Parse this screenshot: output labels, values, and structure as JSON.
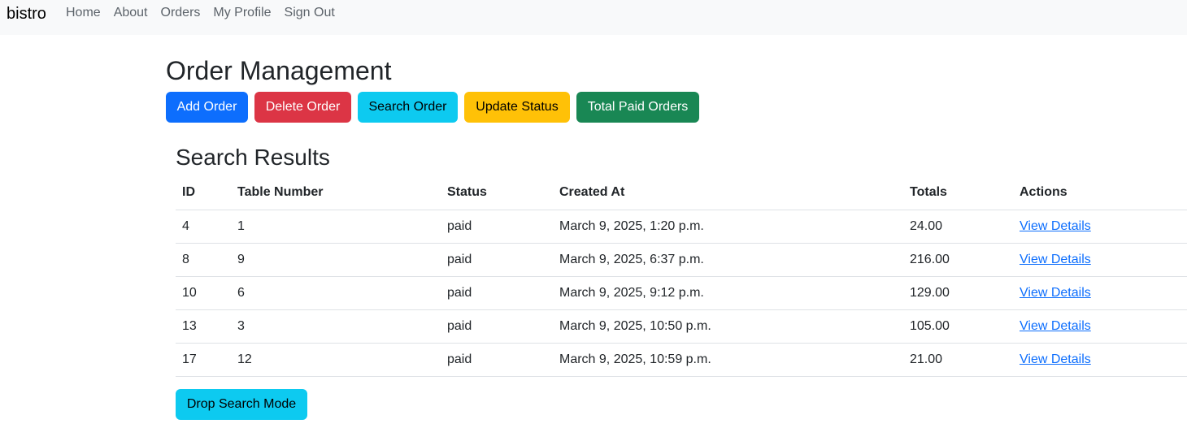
{
  "navbar": {
    "brand": "bistro",
    "links": [
      "Home",
      "About",
      "Orders",
      "My Profile",
      "Sign Out"
    ]
  },
  "page_title": "Order Management",
  "actions": {
    "add": "Add Order",
    "delete": "Delete Order",
    "search": "Search Order",
    "update": "Update Status",
    "total_paid": "Total Paid Orders"
  },
  "results": {
    "title": "Search Results",
    "headers": [
      "ID",
      "Table Number",
      "Status",
      "Created At",
      "Totals",
      "Actions"
    ],
    "rows": [
      {
        "id": "4",
        "table": "1",
        "status": "paid",
        "created": "March 9, 2025, 1:20 p.m.",
        "total": "24.00",
        "action": "View Details"
      },
      {
        "id": "8",
        "table": "9",
        "status": "paid",
        "created": "March 9, 2025, 6:37 p.m.",
        "total": "216.00",
        "action": "View Details"
      },
      {
        "id": "10",
        "table": "6",
        "status": "paid",
        "created": "March 9, 2025, 9:12 p.m.",
        "total": "129.00",
        "action": "View Details"
      },
      {
        "id": "13",
        "table": "3",
        "status": "paid",
        "created": "March 9, 2025, 10:50 p.m.",
        "total": "105.00",
        "action": "View Details"
      },
      {
        "id": "17",
        "table": "12",
        "status": "paid",
        "created": "March 9, 2025, 10:59 p.m.",
        "total": "21.00",
        "action": "View Details"
      }
    ]
  },
  "drop_search": "Drop Search Mode",
  "colors": {
    "primary": "#0d6efd",
    "danger": "#dc3545",
    "info": "#0dcaf0",
    "warning": "#ffc107",
    "success": "#198754",
    "navbar_bg": "#f8f9fa"
  }
}
